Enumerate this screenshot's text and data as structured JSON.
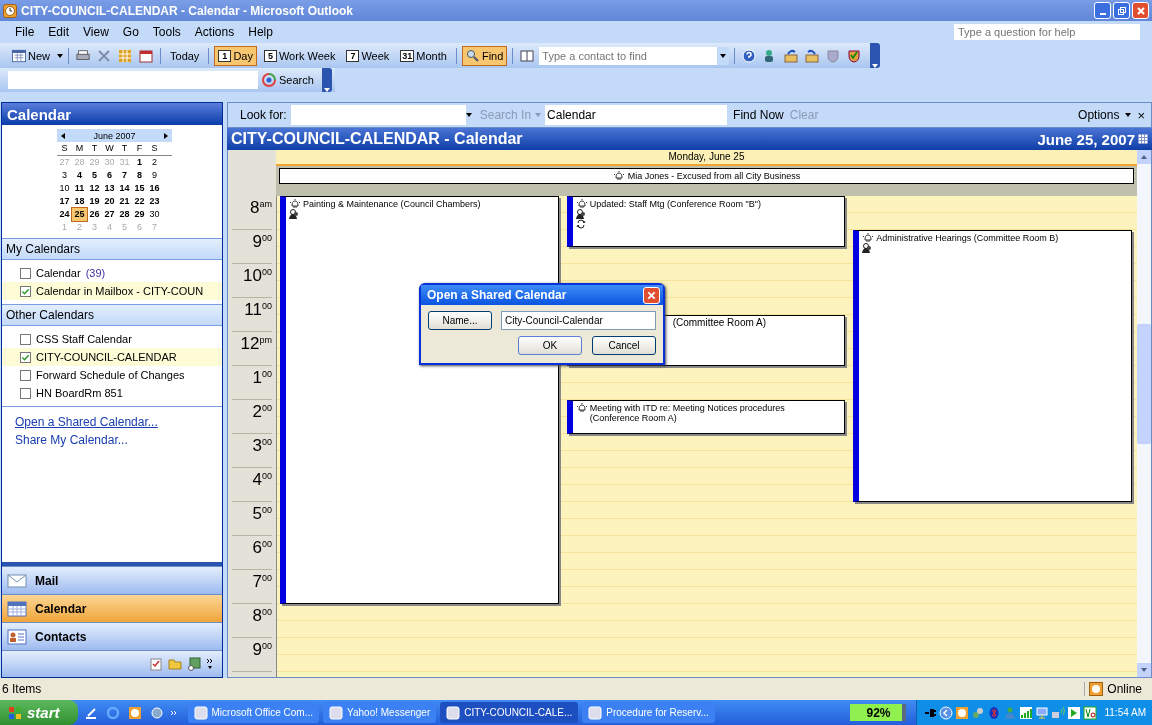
{
  "window": {
    "title": "CITY-COUNCIL-CALENDAR - Calendar - Microsoft Outlook"
  },
  "menu": [
    "File",
    "Edit",
    "View",
    "Go",
    "Tools",
    "Actions",
    "Help"
  ],
  "help_box": {
    "placeholder": "Type a question for help"
  },
  "toolbar": {
    "new": "New",
    "today": "Today",
    "views": [
      {
        "badge": "1",
        "label": "Day",
        "selected": true
      },
      {
        "badge": "5",
        "label": "Work Week",
        "selected": false
      },
      {
        "badge": "7",
        "label": "Week",
        "selected": false
      },
      {
        "badge": "31",
        "label": "Month",
        "selected": false
      }
    ],
    "find": {
      "label": "Find",
      "selected": true
    },
    "contact_search": {
      "placeholder": "Type a contact to find"
    }
  },
  "search_bar": {
    "button": "Search"
  },
  "navigation": {
    "title": "Calendar",
    "mini_calendar": {
      "month": "June 2007",
      "weekdays": [
        "S",
        "M",
        "T",
        "W",
        "T",
        "F",
        "S"
      ],
      "weeks": [
        [
          {
            "d": "27",
            "kind": "other",
            "selected": false
          },
          {
            "d": "28",
            "kind": "other",
            "selected": false
          },
          {
            "d": "29",
            "kind": "other",
            "selected": false
          },
          {
            "d": "30",
            "kind": "other",
            "selected": false
          },
          {
            "d": "31",
            "kind": "other",
            "selected": false
          },
          {
            "d": "1",
            "kind": "busy",
            "selected": false
          },
          {
            "d": "2",
            "kind": "free",
            "selected": false
          }
        ],
        [
          {
            "d": "3",
            "kind": "free",
            "selected": false
          },
          {
            "d": "4",
            "kind": "busy",
            "selected": false
          },
          {
            "d": "5",
            "kind": "busy",
            "selected": false
          },
          {
            "d": "6",
            "kind": "busy",
            "selected": false
          },
          {
            "d": "7",
            "kind": "busy",
            "selected": false
          },
          {
            "d": "8",
            "kind": "busy",
            "selected": false
          },
          {
            "d": "9",
            "kind": "free",
            "selected": false
          }
        ],
        [
          {
            "d": "10",
            "kind": "free",
            "selected": false
          },
          {
            "d": "11",
            "kind": "busy",
            "selected": false
          },
          {
            "d": "12",
            "kind": "busy",
            "selected": false
          },
          {
            "d": "13",
            "kind": "busy",
            "selected": false
          },
          {
            "d": "14",
            "kind": "busy",
            "selected": false
          },
          {
            "d": "15",
            "kind": "busy",
            "selected": false
          },
          {
            "d": "16",
            "kind": "busy",
            "selected": false
          }
        ],
        [
          {
            "d": "17",
            "kind": "busy",
            "selected": false
          },
          {
            "d": "18",
            "kind": "busy",
            "selected": false
          },
          {
            "d": "19",
            "kind": "busy",
            "selected": false
          },
          {
            "d": "20",
            "kind": "busy",
            "selected": false
          },
          {
            "d": "21",
            "kind": "busy",
            "selected": false
          },
          {
            "d": "22",
            "kind": "busy",
            "selected": false
          },
          {
            "d": "23",
            "kind": "busy",
            "selected": false
          }
        ],
        [
          {
            "d": "24",
            "kind": "busy",
            "selected": false
          },
          {
            "d": "25",
            "kind": "busy",
            "selected": true
          },
          {
            "d": "26",
            "kind": "busy",
            "selected": false
          },
          {
            "d": "27",
            "kind": "busy",
            "selected": false
          },
          {
            "d": "28",
            "kind": "busy",
            "selected": false
          },
          {
            "d": "29",
            "kind": "busy",
            "selected": false
          },
          {
            "d": "30",
            "kind": "free",
            "selected": false
          }
        ],
        [
          {
            "d": "1",
            "kind": "other",
            "selected": false
          },
          {
            "d": "2",
            "kind": "other",
            "selected": false
          },
          {
            "d": "3",
            "kind": "other",
            "selected": false
          },
          {
            "d": "4",
            "kind": "other",
            "selected": false
          },
          {
            "d": "5",
            "kind": "other",
            "selected": false
          },
          {
            "d": "6",
            "kind": "other",
            "selected": false
          },
          {
            "d": "7",
            "kind": "other",
            "selected": false
          }
        ]
      ]
    },
    "groups": [
      {
        "title": "My Calendars",
        "items": [
          {
            "label": "Calendar",
            "count": "(39)",
            "checked": false
          },
          {
            "label": "Calendar in Mailbox - CITY-COUN",
            "checked": true
          }
        ]
      },
      {
        "title": "Other Calendars",
        "items": [
          {
            "label": "CSS Staff Calendar",
            "checked": false
          },
          {
            "label": "CITY-COUNCIL-CALENDAR",
            "checked": true
          },
          {
            "label": "Forward Schedule of Changes",
            "checked": false
          },
          {
            "label": "HN BoardRm 851",
            "checked": false
          }
        ]
      }
    ],
    "links": [
      "Open a Shared Calendar...",
      "Share My Calendar..."
    ],
    "buttons": [
      {
        "label": "Mail",
        "selected": false
      },
      {
        "label": "Calendar",
        "selected": true
      },
      {
        "label": "Contacts",
        "selected": false
      }
    ]
  },
  "find_bar": {
    "label": "Look for:",
    "search_in": "Search In",
    "scope": "Calendar",
    "find_now": "Find Now",
    "clear": "Clear",
    "options": "Options",
    "close": "×"
  },
  "calendar": {
    "title": "CITY-COUNCIL-CALENDAR - Calendar",
    "date": "June 25, 2007",
    "day_header": "Monday, June 25",
    "all_day": [
      {
        "title": "Mia Jones - Excused from all City Business",
        "reminder": true
      }
    ],
    "hours": [
      {
        "hour": "8",
        "suffix": "am"
      },
      {
        "hour": "9",
        "suffix": "00"
      },
      {
        "hour": "10",
        "suffix": "00"
      },
      {
        "hour": "11",
        "suffix": "00"
      },
      {
        "hour": "12",
        "suffix": "pm"
      },
      {
        "hour": "1",
        "suffix": "00"
      },
      {
        "hour": "2",
        "suffix": "00"
      },
      {
        "hour": "3",
        "suffix": "00"
      },
      {
        "hour": "4",
        "suffix": "00"
      },
      {
        "hour": "5",
        "suffix": "00"
      },
      {
        "hour": "6",
        "suffix": "00"
      },
      {
        "hour": "7",
        "suffix": "00"
      },
      {
        "hour": "8",
        "suffix": "00"
      },
      {
        "hour": "9",
        "suffix": "00"
      }
    ],
    "events": [
      {
        "title": "Painting & Maintenance (Council Chambers)",
        "reminder": true,
        "meeting": true,
        "recurring": false,
        "covered": false
      },
      {
        "title": "Updated: Staff Mtg (Conference Room \"B\")",
        "reminder": true,
        "meeting": true,
        "recurring": true,
        "covered": false
      },
      {
        "title": "Administrative Hearings (Committee Room B)",
        "reminder": true,
        "meeting": true,
        "recurring": false,
        "covered": false
      },
      {
        "title": "(Committee Room A)",
        "reminder": false,
        "meeting": false,
        "recurring": false,
        "covered": true
      },
      {
        "title": "Meeting with ITD re:  Meeting Notices procedures (Conference Room A)",
        "reminder": true,
        "meeting": false,
        "recurring": false,
        "covered": false
      }
    ]
  },
  "dialog": {
    "title": "Open a Shared Calendar",
    "name_button": "Name...",
    "name_value": "City-Council-Calendar",
    "ok": "OK",
    "cancel": "Cancel"
  },
  "status_bar": {
    "items": "6 Items",
    "connection": "Online"
  },
  "taskbar": {
    "start": "start",
    "tasks": [
      {
        "label": "Microsoft Office Com...",
        "selected": false
      },
      {
        "label": "Yahoo! Messenger",
        "selected": false
      },
      {
        "label": "CITY-COUNCIL-CALE...",
        "selected": true
      },
      {
        "label": "Procedure for Reserv...",
        "selected": false
      }
    ],
    "battery": {
      "reading": "92%",
      "level": 0.92
    },
    "clock": "11:54 AM"
  }
}
